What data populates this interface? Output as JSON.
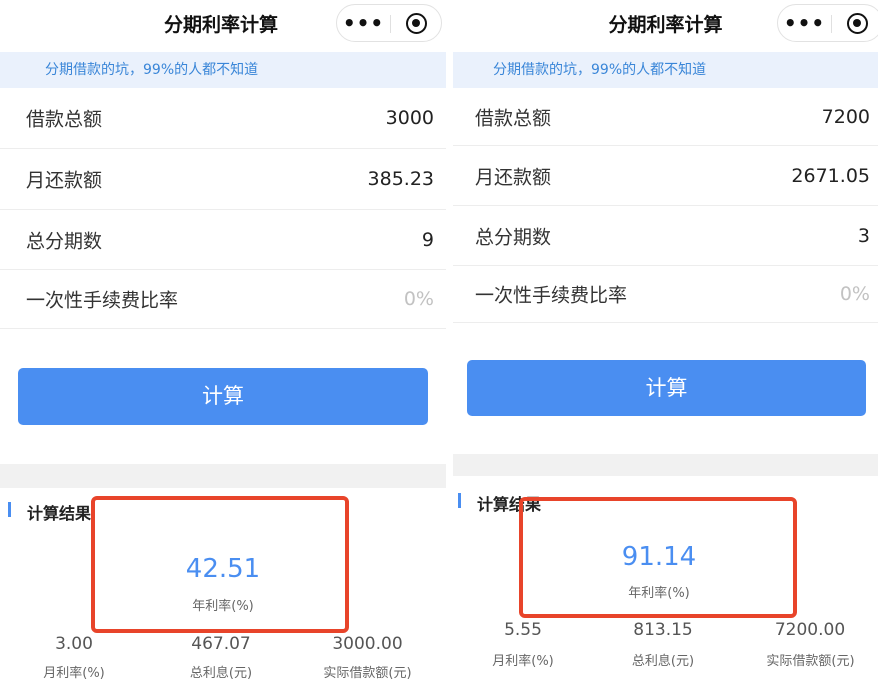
{
  "left": {
    "nav_title": "分期利率计算",
    "capsule": {
      "more_icon": "ellipsis-icon",
      "target_icon": "target-icon",
      "more_label": "•••"
    },
    "banner": "分期借款的坑，99%的人都不知道",
    "rows": [
      {
        "label": "借款总额",
        "value": "3000"
      },
      {
        "label": "月还款额",
        "value": "385.23"
      },
      {
        "label": "总分期数",
        "value": "9"
      },
      {
        "label": "一次性手续费比率",
        "value": "0%"
      }
    ],
    "button": "计算",
    "result_title": "计算结果",
    "annual_rate": {
      "value": "42.51",
      "label": "年利率(%)"
    },
    "stats": [
      {
        "value": "3.00",
        "label": "月利率(%)"
      },
      {
        "value": "467.07",
        "label": "总利息(元)"
      },
      {
        "value": "3000.00",
        "label": "实际借款额(元)"
      }
    ]
  },
  "right": {
    "nav_title": "分期利率计算",
    "capsule": {
      "more_icon": "ellipsis-icon",
      "target_icon": "target-icon",
      "more_label": "•••"
    },
    "banner": "分期借款的坑，99%的人都不知道",
    "rows": [
      {
        "label": "借款总额",
        "value": "7200"
      },
      {
        "label": "月还款额",
        "value": "2671.05"
      },
      {
        "label": "总分期数",
        "value": "3"
      },
      {
        "label": "一次性手续费比率",
        "value": "0%"
      }
    ],
    "button": "计算",
    "result_title": "计算结果",
    "annual_rate": {
      "value": "91.14",
      "label": "年利率(%)"
    },
    "stats": [
      {
        "value": "5.55",
        "label": "月利率(%)"
      },
      {
        "value": "813.15",
        "label": "总利息(元)"
      },
      {
        "value": "7200.00",
        "label": "实际借款额(元)"
      }
    ]
  },
  "colors": {
    "accent": "#4a8ef1",
    "banner_bg": "#eaf1fc",
    "banner_text": "#3a86d8",
    "highlight": "#e8442a"
  }
}
